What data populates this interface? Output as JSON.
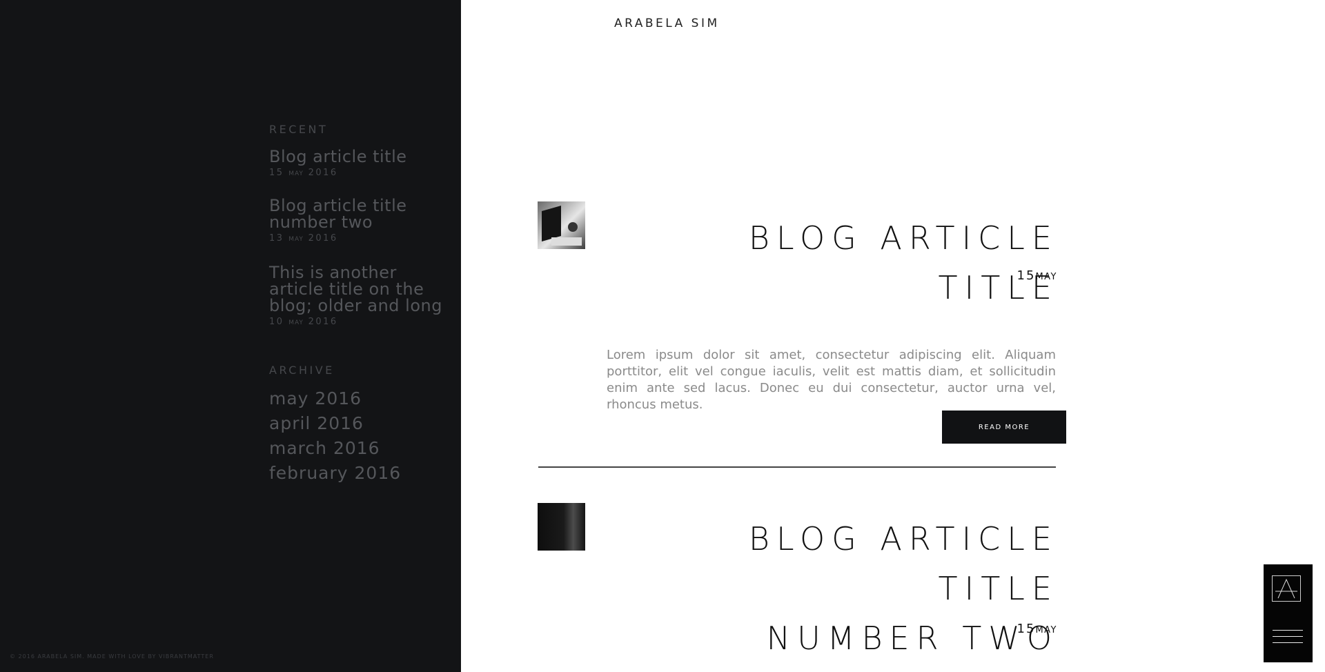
{
  "sidebar": {
    "recent_heading": "Recent",
    "recent": [
      {
        "title": "Blog article title",
        "day": "15",
        "month": "may",
        "year": "2016"
      },
      {
        "title": "Blog article title number two",
        "day": "13",
        "month": "may",
        "year": "2016"
      },
      {
        "title": "This is another article title on the blog; older and long",
        "day": "10",
        "month": "may",
        "year": "2016"
      }
    ],
    "archive_heading": "Archive",
    "archive": [
      "may 2016",
      "april 2016",
      "march 2016",
      "february 2016"
    ],
    "copyright": "© 2016 Arabela Sim. Made with love by Vibrantmatter"
  },
  "header": {
    "site_title": "Arabela Sim"
  },
  "posts": [
    {
      "title": "Blog article title",
      "day": "15",
      "month": "May",
      "excerpt": "Lorem ipsum dolor sit amet, consectetur adipiscing elit. Aliquam porttitor, elit vel congue iaculis, velit est mattis diam, et sollicitudin enim ante sed lacus. Donec eu dui consectetur, auctor urna vel, rhoncus metus.",
      "read_more": "Read more"
    },
    {
      "title_line1": "Blog article title",
      "title_line2": "number two",
      "day": "15",
      "month": "May"
    }
  ],
  "colors": {
    "sidebar_bg": "#131416",
    "accent": "#111214"
  }
}
